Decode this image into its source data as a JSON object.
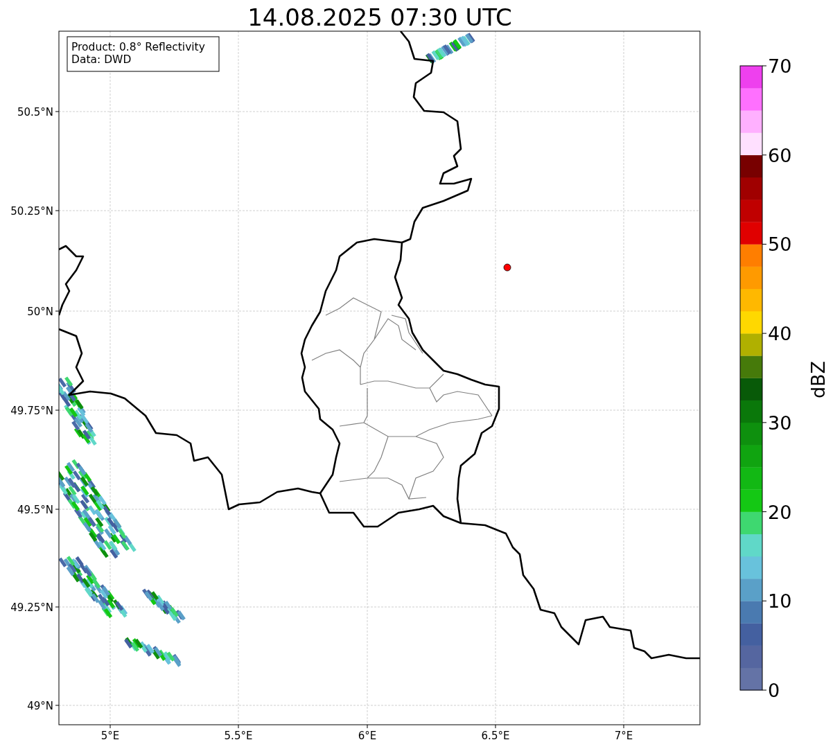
{
  "title": "14.08.2025 07:30 UTC",
  "info_box": [
    "Product: 0.8° Reflectivity",
    "Data: DWD"
  ],
  "y_ticks": [
    "50.5°N",
    "50.25°N",
    "50°N",
    "49.75°N",
    "49.5°N",
    "49.25°N",
    "49°N"
  ],
  "x_ticks": [
    "5°E",
    "5.5°E",
    "6°E",
    "6.5°E",
    "7°E"
  ],
  "colorbar": {
    "label": "dBZ",
    "ticks": [
      "70",
      "60",
      "50",
      "40",
      "30",
      "20",
      "10",
      "0"
    ],
    "bands": [
      {
        "color": "#6473a6"
      },
      {
        "color": "#5566a0"
      },
      {
        "color": "#4460a0"
      },
      {
        "color": "#4a7ab0"
      },
      {
        "color": "#5aa0c8"
      },
      {
        "color": "#68c2dc"
      },
      {
        "color": "#60d8c8"
      },
      {
        "color": "#3ed870"
      },
      {
        "color": "#14c814"
      },
      {
        "color": "#12b814"
      },
      {
        "color": "#10a410"
      },
      {
        "color": "#0e900e"
      },
      {
        "color": "#0a780a"
      },
      {
        "color": "#085a08"
      },
      {
        "color": "#467a0a"
      },
      {
        "color": "#b0b000"
      },
      {
        "color": "#ffd800"
      },
      {
        "color": "#ffb800"
      },
      {
        "color": "#ff9a00"
      },
      {
        "color": "#ff7e00"
      },
      {
        "color": "#e00000"
      },
      {
        "color": "#c00000"
      },
      {
        "color": "#a00000"
      },
      {
        "color": "#780000"
      },
      {
        "color": "#ffe0ff"
      },
      {
        "color": "#ffb0ff"
      },
      {
        "color": "#ff70ff"
      },
      {
        "color": "#ee40ee"
      }
    ]
  }
}
